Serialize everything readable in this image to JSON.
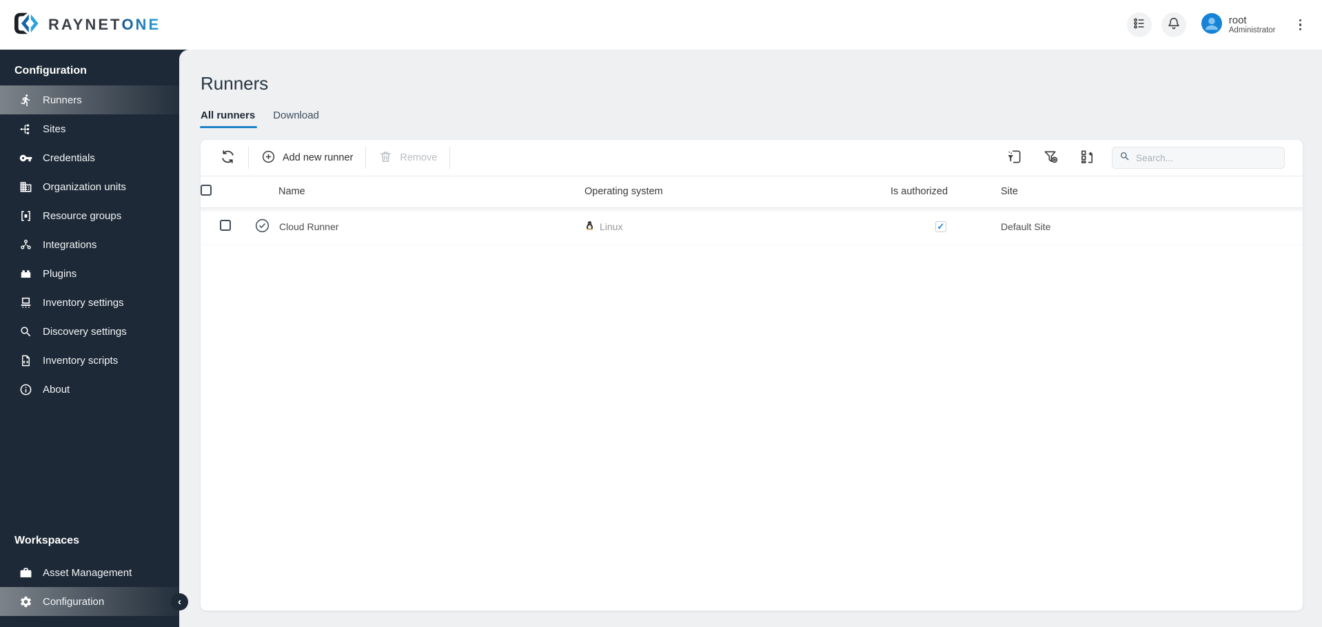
{
  "brand": {
    "logo_text_primary": "RAYNET",
    "logo_text_secondary": "ONE"
  },
  "topbar": {
    "user_name": "root",
    "user_role": "Administrator"
  },
  "sidebar": {
    "section_title": "Configuration",
    "items": [
      {
        "label": "Runners",
        "icon": "runner-icon",
        "active": true
      },
      {
        "label": "Sites",
        "icon": "sites-hierarchy-icon",
        "active": false
      },
      {
        "label": "Credentials",
        "icon": "key-icon",
        "active": false
      },
      {
        "label": "Organization units",
        "icon": "building-icon",
        "active": false
      },
      {
        "label": "Resource groups",
        "icon": "resource-group-icon",
        "active": false
      },
      {
        "label": "Integrations",
        "icon": "integration-nodes-icon",
        "active": false
      },
      {
        "label": "Plugins",
        "icon": "plugin-brick-icon",
        "active": false
      },
      {
        "label": "Inventory settings",
        "icon": "inventory-machine-icon",
        "active": false
      },
      {
        "label": "Discovery settings",
        "icon": "magnifier-icon",
        "active": false
      },
      {
        "label": "Inventory scripts",
        "icon": "script-file-icon",
        "active": false
      },
      {
        "label": "About",
        "icon": "info-icon",
        "active": false
      }
    ],
    "workspaces_title": "Workspaces",
    "workspaces": [
      {
        "label": "Asset Management",
        "icon": "briefcase-icon",
        "active": false
      },
      {
        "label": "Configuration",
        "icon": "gear-icon",
        "active": true
      }
    ]
  },
  "page": {
    "title": "Runners",
    "tabs": [
      {
        "label": "All runners",
        "active": true
      },
      {
        "label": "Download",
        "active": false
      }
    ]
  },
  "toolbar": {
    "add_label": "Add new runner",
    "remove_label": "Remove",
    "search_placeholder": "Search..."
  },
  "table": {
    "columns": [
      "Name",
      "Operating system",
      "Is authorized",
      "Site"
    ],
    "rows": [
      {
        "name": "Cloud Runner",
        "os": "Linux",
        "os_icon": "linux-tux-icon",
        "authorized": true,
        "authorized_glyph": "✓",
        "site": "Default Site"
      }
    ]
  },
  "colors": {
    "accent_blue": "#1e83c6",
    "sidebar_bg": "#1d2936",
    "checkbox_check_blue": "#1a7fd6",
    "linux_yellow": "#f0a81c",
    "avatar_blue": "#1583d6"
  }
}
